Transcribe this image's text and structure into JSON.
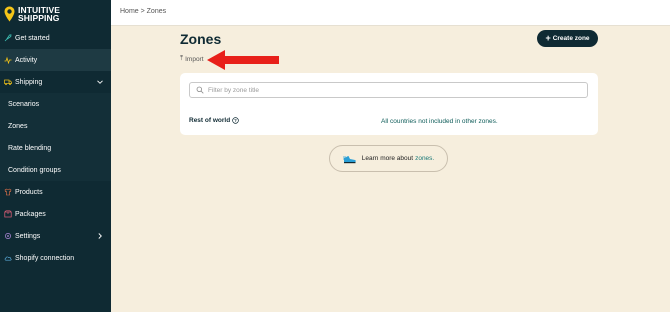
{
  "brand": {
    "line1": "INTUITIVE",
    "line2": "SHIPPING"
  },
  "sidebar": {
    "items": [
      {
        "label": "Get started",
        "icon": "rocket-icon"
      },
      {
        "label": "Activity",
        "icon": "activity-icon"
      },
      {
        "label": "Shipping",
        "icon": "truck-icon"
      },
      {
        "label": "Products",
        "icon": "shirt-icon"
      },
      {
        "label": "Packages",
        "icon": "package-icon"
      },
      {
        "label": "Settings",
        "icon": "gear-icon"
      },
      {
        "label": "Shopify connection",
        "icon": "cloud-icon"
      }
    ],
    "shipping_sub": [
      {
        "label": "Scenarios"
      },
      {
        "label": "Zones"
      },
      {
        "label": "Rate blending"
      },
      {
        "label": "Condition groups"
      }
    ]
  },
  "breadcrumb": "Home > Zones",
  "page": {
    "title": "Zones",
    "create_label": "Create zone",
    "import_label": "Import",
    "filter_placeholder": "Filter by zone title",
    "zone": {
      "name": "Rest of world",
      "description": "All countries not included in other zones."
    },
    "learn": {
      "prefix": "Learn more about",
      "link": "zones."
    }
  },
  "colors": {
    "sidebar": "#0f2a33",
    "background": "#f6eedd",
    "accent": "#f5c518",
    "annotation_arrow": "#e8201a"
  }
}
